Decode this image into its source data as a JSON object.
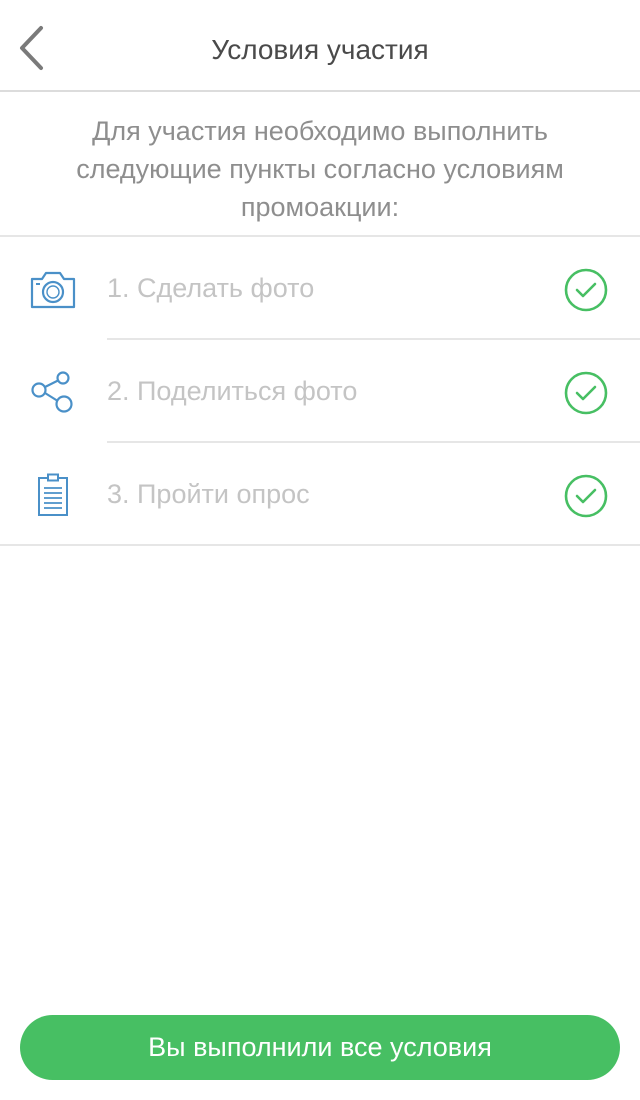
{
  "colors": {
    "accent_blue": "#4a90c8",
    "success_green": "#47bf63",
    "label_gray": "#c4c4c4",
    "text_gray": "#8e8e8e"
  },
  "header": {
    "back_icon": "chevron-left-icon",
    "title": "Условия участия"
  },
  "intro": {
    "text": "Для участия необходимо выполнить следующие пункты согласно условиям промоакции:"
  },
  "conditions": [
    {
      "icon": "camera-icon",
      "label": "1. Сделать фото",
      "status": "completed",
      "status_icon": "check-circle-icon"
    },
    {
      "icon": "share-icon",
      "label": "2. Поделиться фото",
      "status": "completed",
      "status_icon": "check-circle-icon"
    },
    {
      "icon": "clipboard-icon",
      "label": "3. Пройти опрос",
      "status": "completed",
      "status_icon": "check-circle-icon"
    }
  ],
  "footer": {
    "button_label": "Вы выполнили все условия"
  }
}
